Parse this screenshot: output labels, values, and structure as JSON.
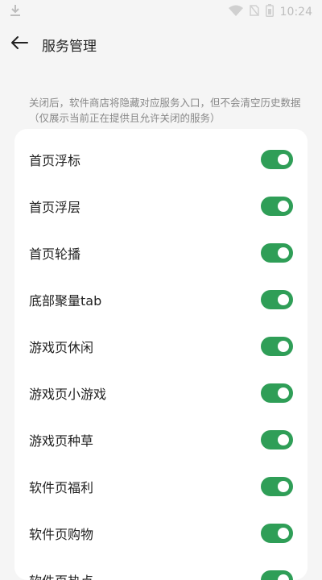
{
  "status_bar": {
    "time": "10:24",
    "icons": [
      "download-icon",
      "wifi-icon",
      "no-sim-icon",
      "battery-icon"
    ]
  },
  "header": {
    "title": "服务管理",
    "back_icon": "arrow-left-icon"
  },
  "description": "关闭后，软件商店将隐藏对应服务入口，但不会清空历史数据（仅展示当前正在提供且允许关闭的服务）",
  "settings": {
    "items": [
      {
        "label": "首页浮标",
        "enabled": true
      },
      {
        "label": "首页浮层",
        "enabled": true
      },
      {
        "label": "首页轮播",
        "enabled": true
      },
      {
        "label": "底部聚量tab",
        "enabled": true
      },
      {
        "label": "游戏页休闲",
        "enabled": true
      },
      {
        "label": "游戏页小游戏",
        "enabled": true
      },
      {
        "label": "游戏页种草",
        "enabled": true
      },
      {
        "label": "软件页福利",
        "enabled": true
      },
      {
        "label": "软件页购物",
        "enabled": true
      },
      {
        "label": "软件页热点",
        "enabled": true
      }
    ]
  },
  "colors": {
    "accent": "#2f9e57",
    "background": "#f5f5f5",
    "card": "#ffffff",
    "description_text": "#888888"
  }
}
